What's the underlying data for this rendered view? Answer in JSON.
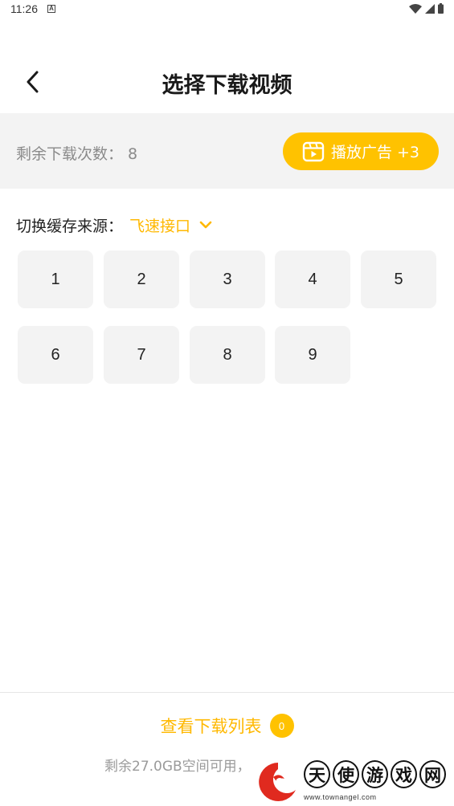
{
  "status_bar": {
    "time": "11:26",
    "notification_glyph": "A"
  },
  "header": {
    "title": "选择下载视频",
    "back_icon": "chevron-left-icon"
  },
  "quota": {
    "text": "剩余下载次数：  8",
    "ad_button_label": "播放广告 +3",
    "ad_button_icon": "video-play-icon",
    "accent_color": "#ffc200"
  },
  "source": {
    "label": "切换缓存来源：",
    "value": "飞速接口",
    "dropdown_icon": "chevron-down-icon"
  },
  "episodes": [
    "1",
    "2",
    "3",
    "4",
    "5",
    "6",
    "7",
    "8",
    "9"
  ],
  "footer": {
    "download_list_label": "查看下载列表",
    "download_count": "0",
    "storage_text": "剩余27.0GB空间可用，"
  },
  "watermark": {
    "chars": [
      "天",
      "使",
      "游",
      "戏",
      "网"
    ],
    "url": "www.townangel.com"
  }
}
